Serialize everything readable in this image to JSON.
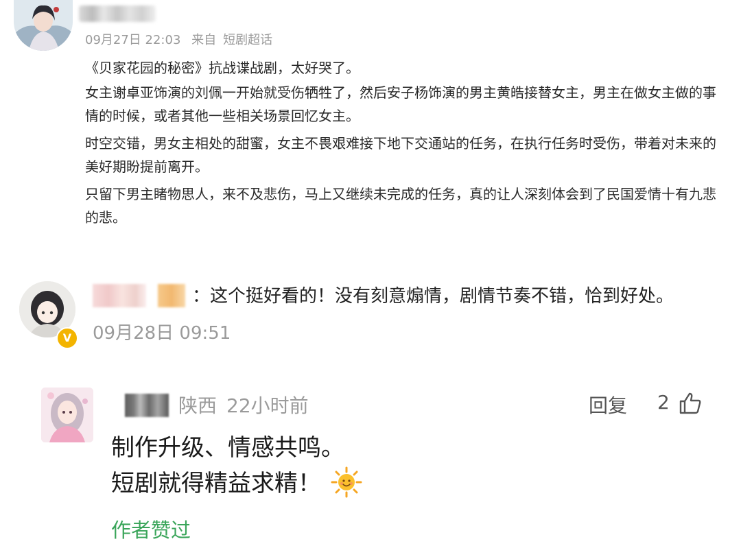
{
  "post": {
    "date": "09月27日 22:03",
    "source_prefix": "来自",
    "source": "短剧超话",
    "paragraphs": [
      "《贝家花园的秘密》抗战谍战剧，太好哭了。",
      "女主谢卓亚饰演的刘佩一开始就受伤牺牲了，然后安子杨饰演的男主黄皓接替女主，男主在做女主做的事情的时候，或者其他一些相关场景回忆女主。",
      "时空交错，男女主相处的甜蜜，女主不畏艰难接下地下交通站的任务，在执行任务时受伤，带着对未来的美好期盼提前离开。",
      "只留下男主睹物思人，来不及悲伤，马上又继续未完成的任务，真的让人深刻体会到了民国爱情十有九悲的悲。"
    ]
  },
  "comment": {
    "text": "：这个挺好看的！没有刻意煽情，剧情节奏不错，恰到好处。",
    "time": "09月28日 09:51",
    "badge": "V"
  },
  "reply": {
    "location": "陕西",
    "time_ago": "22小时前",
    "reply_label": "回复",
    "like_count": "2",
    "lines": [
      "制作升级、情感共鸣。",
      "短剧就得精益求精！"
    ],
    "author_liked": "作者赞过"
  },
  "icons": {
    "like": "thumbs-up-icon",
    "sun": "sun-emoji-icon",
    "verified": "verified-badge-icon"
  },
  "colors": {
    "meta_gray": "#9a9a9a",
    "author_liked_green": "#3aa55a",
    "badge_yellow": "#f3b400"
  }
}
